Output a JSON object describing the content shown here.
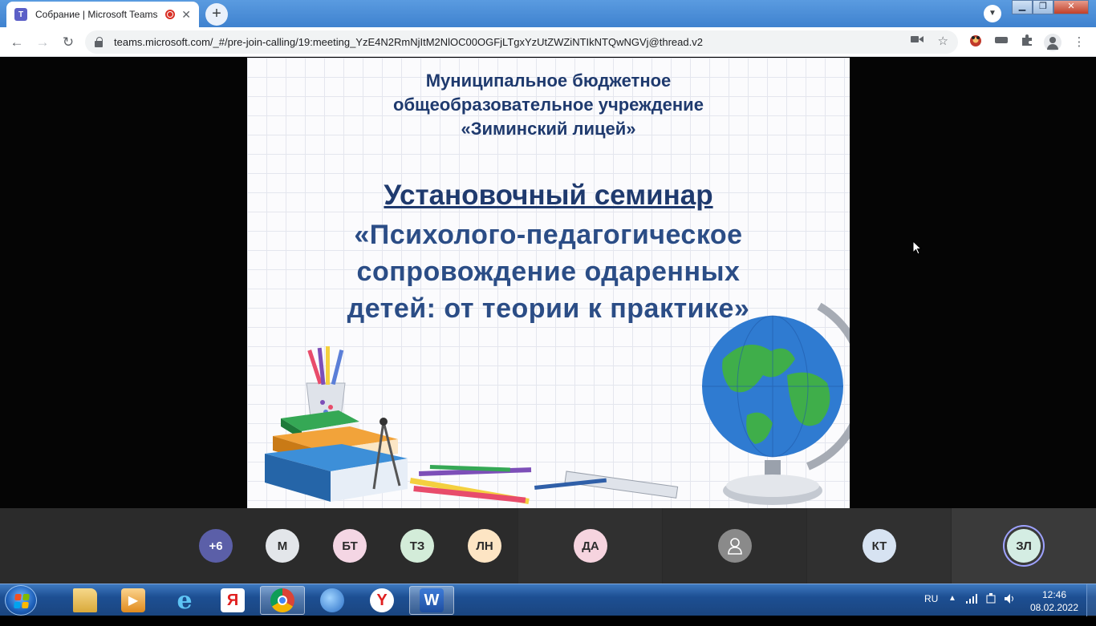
{
  "browser": {
    "tab_title": "Собрание | Microsoft Teams",
    "tab_icon": "teams-icon",
    "url": "teams.microsoft.com/_#/pre-join-calling/19:meeting_YzE4N2RmNjItM2NlOC00OGFjLTgxYzUtZWZiNTIkNTQwNGVj@thread.v2"
  },
  "slide": {
    "org_lines": [
      "Муниципальное бюджетное",
      "общеобразовательное учреждение",
      "«Зиминский лицей»"
    ],
    "seminar": "Установочный семинар",
    "topic_lines": [
      "«Психолого-педагогическое",
      "сопровождение одаренных",
      "детей: от теории к практике»"
    ]
  },
  "participants": [
    {
      "initials": "+6",
      "bg": "#5b5fa8",
      "fg": "#ffffff"
    },
    {
      "initials": "М",
      "bg": "#e3e6ea",
      "fg": "#2b2b2b"
    },
    {
      "initials": "БТ",
      "bg": "#f4d6e4",
      "fg": "#2b2b2b"
    },
    {
      "initials": "ТЗ",
      "bg": "#d3ecd9",
      "fg": "#2b2b2b"
    },
    {
      "initials": "ЛН",
      "bg": "#fde5c4",
      "fg": "#2b2b2b"
    },
    {
      "initials": "ДА",
      "bg": "#f6d4df",
      "fg": "#2b2b2b"
    },
    {
      "initials": "",
      "bg": "#8a8a8a",
      "fg": "#ffffff",
      "icon": "person-icon"
    },
    {
      "initials": "КТ",
      "bg": "#d7e3f2",
      "fg": "#2b2b2b"
    },
    {
      "initials": "ЗЛ",
      "bg": "#d4ede3",
      "fg": "#2b2b2b",
      "speaking": true
    }
  ],
  "taskbar": {
    "apps": [
      "explorer-icon",
      "media-player-icon",
      "internet-explorer-icon",
      "yandex-icon",
      "chrome-icon",
      "network-globe-icon",
      "yandex-browser-icon",
      "word-icon"
    ],
    "yandex_label": "Я",
    "word_label": "W",
    "language": "RU",
    "time": "12:46",
    "date": "08.02.2022"
  },
  "colors": {
    "slide_text": "#1f3a6e",
    "teams": "#5b5fc7",
    "taskbar": "#1d4f93"
  }
}
